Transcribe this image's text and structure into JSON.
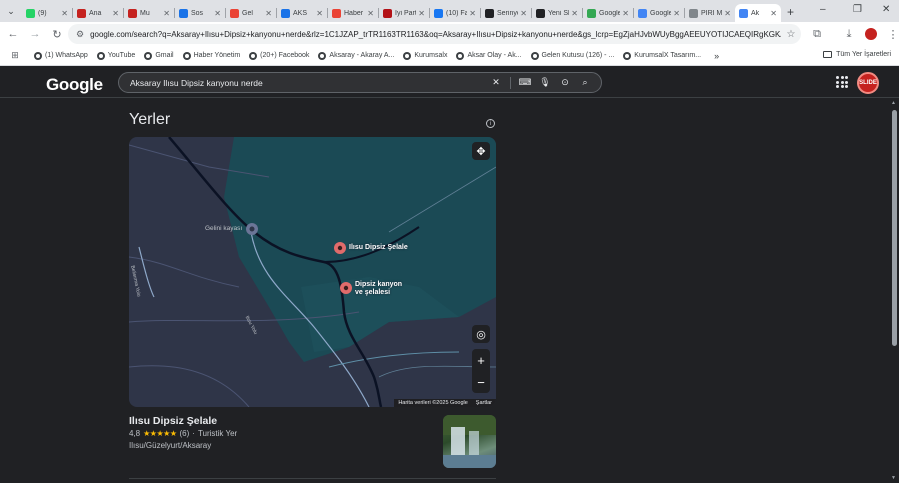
{
  "tabs": [
    {
      "title": "(9)",
      "color": "#25d366"
    },
    {
      "title": "Ana",
      "color": "#c5221f"
    },
    {
      "title": "Mu",
      "color": "#c5221f"
    },
    {
      "title": "Sos",
      "color": "#1a73e8"
    },
    {
      "title": "Gel",
      "color": "#ea4335"
    },
    {
      "title": "AKS",
      "color": "#1a73e8"
    },
    {
      "title": "Haber",
      "color": "#ea4335"
    },
    {
      "title": "İyi Parti",
      "color": "#b31217"
    },
    {
      "title": "(10) Fa",
      "color": "#1877f2"
    },
    {
      "title": "Serinyol",
      "color": "#202124"
    },
    {
      "title": "Yeni Sk",
      "color": "#202124"
    },
    {
      "title": "Google",
      "color": "#34a853"
    },
    {
      "title": "Google",
      "color": "#4285f4"
    },
    {
      "title": "PİRİ MI",
      "color": "#80868b"
    },
    {
      "title": "Ak",
      "color": "#4285f4"
    }
  ],
  "window_controls": {
    "minimize": "–",
    "restore": "❐",
    "close": "✕"
  },
  "toolbar": {
    "url": "google.com/search?q=Aksaray+Ilısu+Dipsiz+kanyonu+nerde&rlz=1C1JZAP_trTR1163TR1163&oq=Aksaray+Ilısu+Dipsiz+kanyonu+nerde&gs_lcrp=EgZjaHJvbWUyBggAEEUYOTIJCAEQIRgKGKABMg..."
  },
  "bookmarks": [
    "(1) WhatsApp",
    "YouTube",
    "Gmail",
    "Haber Yönetim",
    "(20+) Facebook",
    "Aksaray - Akaray A...",
    "Kurumsalx",
    "Aksar Olay - Ak...",
    "Gelen Kutusu (126) - ...",
    "KurumsalX Tasarım..."
  ],
  "bookmarks_more": "»",
  "bookmarks_all": "Tüm Yer İşaretleri",
  "google": {
    "logo": "Google",
    "query": "Aksaray Ilısu Dipsiz kanyonu nerde",
    "avatar_text": "SLIDE"
  },
  "section": {
    "title": "Yerler"
  },
  "map": {
    "poi_1": "Ilısu Dipsiz Şelale",
    "poi_2_line1": "Dipsiz kanyon",
    "poi_2_line2": "ve şelalesi",
    "landmark": "Gelini kayası",
    "attribution": "Harita verileri ©2025 Google",
    "terms": "Şartlar",
    "road_label_1": "Belisırma Yolu",
    "road_label_2": "Ilısu Yolu"
  },
  "place": {
    "name": "Ilısu Dipsiz Şelale",
    "rating": "4,8",
    "stars": "★★★★★",
    "reviews": "(6)",
    "separator": "·",
    "category": "Turistik Yer",
    "address": "Ilısu/Güzelyurt/Aksaray"
  }
}
